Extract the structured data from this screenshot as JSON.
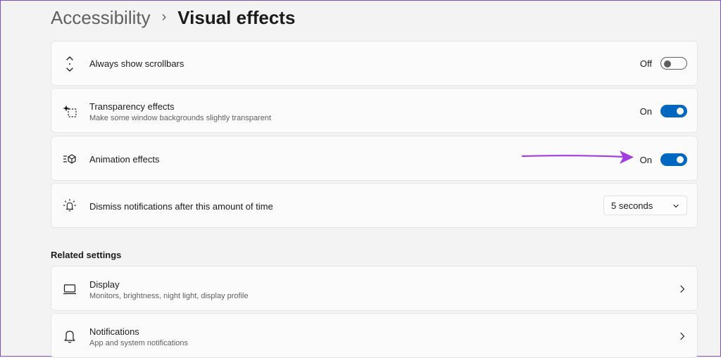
{
  "breadcrumb": {
    "parent": "Accessibility",
    "separator": "›",
    "current": "Visual effects"
  },
  "settings": {
    "scrollbars": {
      "title": "Always show scrollbars",
      "state": "Off",
      "enabled": false,
      "icon": "scrollbar-icon"
    },
    "transparency": {
      "title": "Transparency effects",
      "subtitle": "Make some window backgrounds slightly transparent",
      "state": "On",
      "enabled": true,
      "icon": "transparency-icon"
    },
    "animation": {
      "title": "Animation effects",
      "state": "On",
      "enabled": true,
      "icon": "animation-icon"
    },
    "notifications_time": {
      "title": "Dismiss notifications after this amount of time",
      "value": "5 seconds",
      "icon": "notification-bell-time-icon"
    }
  },
  "related": {
    "heading": "Related settings",
    "items": [
      {
        "title": "Display",
        "subtitle": "Monitors, brightness, night light, display profile",
        "icon": "monitor-icon"
      },
      {
        "title": "Notifications",
        "subtitle": "App and system notifications",
        "icon": "bell-icon"
      }
    ]
  },
  "colors": {
    "accent": "#0067c0",
    "annotation_arrow": "#a23ee0"
  }
}
